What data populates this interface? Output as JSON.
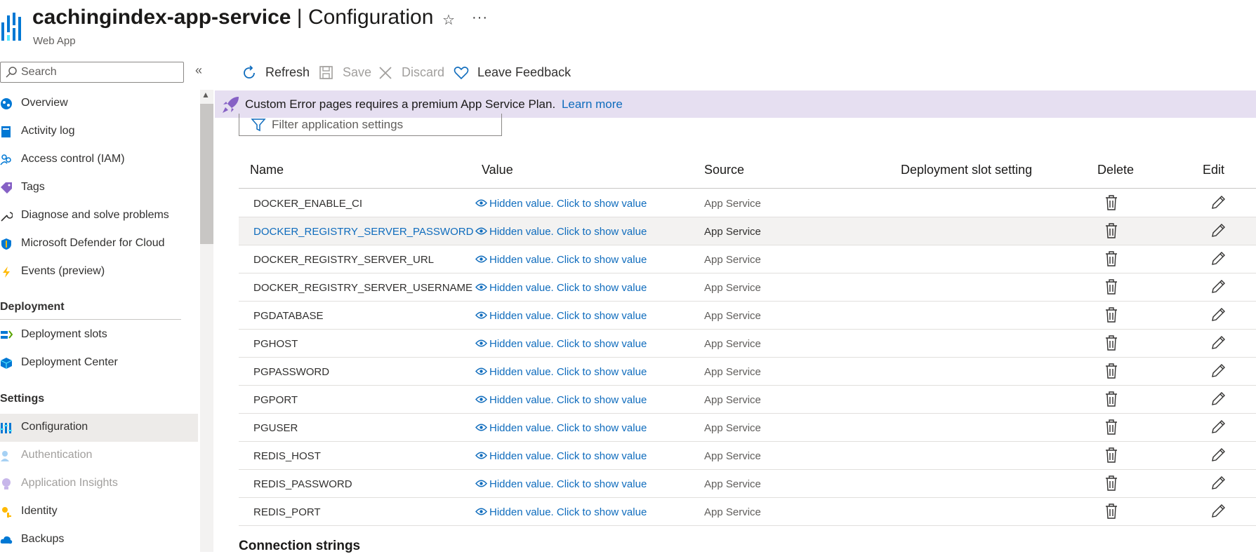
{
  "header": {
    "resource_name": "cachingindex-app-service",
    "separator": " | ",
    "page_name": "Configuration",
    "subtitle": "Web App"
  },
  "sidebar": {
    "search_placeholder": "Search",
    "items": [
      {
        "label": "Overview",
        "icon": "overview-icon"
      },
      {
        "label": "Activity log",
        "icon": "activity-log-icon"
      },
      {
        "label": "Access control (IAM)",
        "icon": "iam-icon"
      },
      {
        "label": "Tags",
        "icon": "tag-icon"
      },
      {
        "label": "Diagnose and solve problems",
        "icon": "wrench-icon"
      },
      {
        "label": "Microsoft Defender for Cloud",
        "icon": "shield-icon"
      },
      {
        "label": "Events (preview)",
        "icon": "lightning-icon"
      }
    ],
    "deployment_section": "Deployment",
    "deployment_items": [
      {
        "label": "Deployment slots",
        "icon": "deployment-slots-icon"
      },
      {
        "label": "Deployment Center",
        "icon": "deployment-center-icon"
      }
    ],
    "settings_section": "Settings",
    "settings_items": [
      {
        "label": "Configuration",
        "icon": "configuration-icon",
        "selected": true
      },
      {
        "label": "Authentication",
        "icon": "authentication-icon",
        "disabled": true
      },
      {
        "label": "Application Insights",
        "icon": "app-insights-icon",
        "disabled": true
      },
      {
        "label": "Identity",
        "icon": "identity-icon"
      },
      {
        "label": "Backups",
        "icon": "backups-icon"
      }
    ]
  },
  "toolbar": {
    "refresh": "Refresh",
    "save": "Save",
    "discard": "Discard",
    "feedback": "Leave Feedback"
  },
  "banner": {
    "message": "Custom Error pages requires a premium App Service Plan.",
    "link": "Learn more"
  },
  "filter": {
    "placeholder": "Filter application settings"
  },
  "table": {
    "columns": {
      "name": "Name",
      "value": "Value",
      "source": "Source",
      "slot": "Deployment slot setting",
      "delete": "Delete",
      "edit": "Edit"
    },
    "rows": [
      {
        "name": "DOCKER_ENABLE_CI",
        "value": "Hidden value. Click to show value",
        "source": "App Service"
      },
      {
        "name": "DOCKER_REGISTRY_SERVER_PASSWORD",
        "value": "Hidden value. Click to show value",
        "source": "App Service"
      },
      {
        "name": "DOCKER_REGISTRY_SERVER_URL",
        "value": "Hidden value. Click to show value",
        "source": "App Service"
      },
      {
        "name": "DOCKER_REGISTRY_SERVER_USERNAME",
        "value": "Hidden value. Click to show value",
        "source": "App Service"
      },
      {
        "name": "PGDATABASE",
        "value": "Hidden value. Click to show value",
        "source": "App Service"
      },
      {
        "name": "PGHOST",
        "value": "Hidden value. Click to show value",
        "source": "App Service"
      },
      {
        "name": "PGPASSWORD",
        "value": "Hidden value. Click to show value",
        "source": "App Service"
      },
      {
        "name": "PGPORT",
        "value": "Hidden value. Click to show value",
        "source": "App Service"
      },
      {
        "name": "PGUSER",
        "value": "Hidden value. Click to show value",
        "source": "App Service"
      },
      {
        "name": "REDIS_HOST",
        "value": "Hidden value. Click to show value",
        "source": "App Service"
      },
      {
        "name": "REDIS_PASSWORD",
        "value": "Hidden value. Click to show value",
        "source": "App Service"
      },
      {
        "name": "REDIS_PORT",
        "value": "Hidden value. Click to show value",
        "source": "App Service"
      }
    ]
  },
  "connection_strings": {
    "heading": "Connection strings"
  },
  "colors": {
    "link": "#0f6cbd",
    "banner_bg": "#e6dff1",
    "selected_bg": "#edebe9"
  }
}
